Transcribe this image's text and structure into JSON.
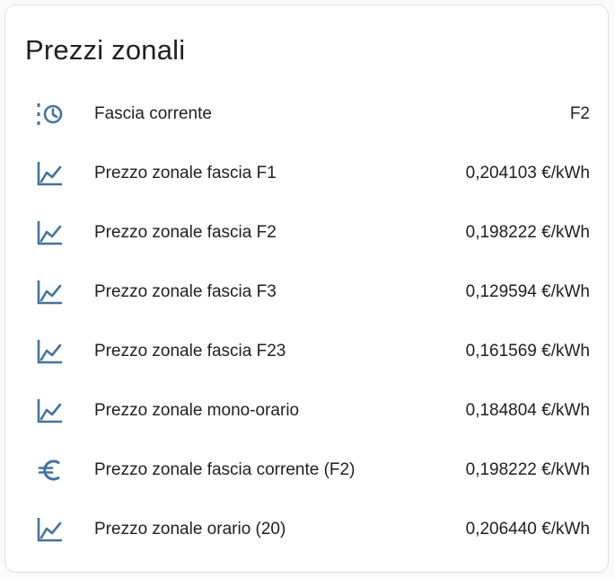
{
  "card": {
    "title": "Prezzi zonali"
  },
  "colors": {
    "icon": "#44739e",
    "text": "#212121",
    "card_border": "#e0e0e0"
  },
  "rows": [
    {
      "icon": "clock-schedule-icon",
      "label": "Fascia corrente",
      "value": "F2"
    },
    {
      "icon": "chart-line-icon",
      "label": "Prezzo zonale fascia F1",
      "value": "0,204103 €/kWh"
    },
    {
      "icon": "chart-line-icon",
      "label": "Prezzo zonale fascia F2",
      "value": "0,198222 €/kWh"
    },
    {
      "icon": "chart-line-icon",
      "label": "Prezzo zonale fascia F3",
      "value": "0,129594 €/kWh"
    },
    {
      "icon": "chart-line-icon",
      "label": "Prezzo zonale fascia F23",
      "value": "0,161569 €/kWh"
    },
    {
      "icon": "chart-line-icon",
      "label": "Prezzo zonale mono-orario",
      "value": "0,184804 €/kWh"
    },
    {
      "icon": "euro-icon",
      "label": "Prezzo zonale fascia corrente (F2)",
      "value": "0,198222 €/kWh"
    },
    {
      "icon": "chart-line-icon",
      "label": "Prezzo zonale orario (20)",
      "value": "0,206440 €/kWh"
    }
  ]
}
